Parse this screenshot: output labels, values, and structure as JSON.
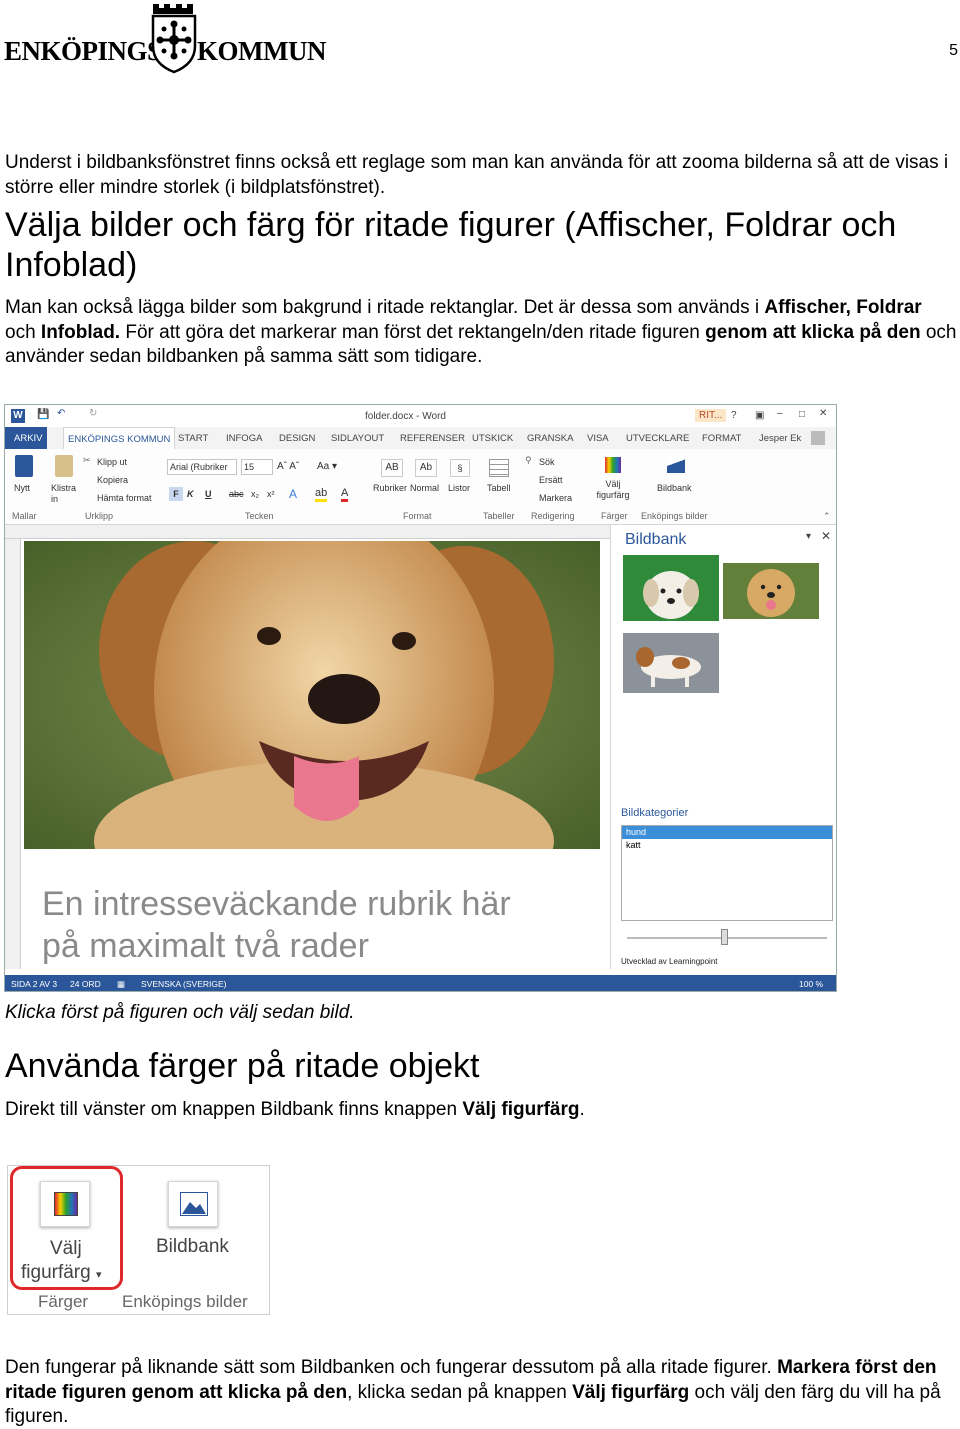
{
  "header": {
    "logo_text_left": "ENKÖPINGS",
    "logo_text_right": "KOMMUN",
    "page_number": "5"
  },
  "intro": "Underst i bildbanksfönstret finns också ett reglage som man kan använda för att zooma bilderna så att de visas i större eller mindre storlek (i bildplatsfönstret).",
  "section1": {
    "heading": "Välja bilder och färg för ritade figurer (Affischer, Foldrar och Infoblad)",
    "p_a": "Man kan också lägga bilder som bakgrund i ritade rektanglar. Det är dessa som används i ",
    "p_b": "Affischer, Foldrar",
    "p_c": " och ",
    "p_d": "Infoblad.",
    "p_e": " För att göra det markerar man först det rektangeln/den ritade figuren ",
    "p_f": "genom att klicka på den",
    "p_g": " och använder sedan bildbanken på samma sätt som tidigare."
  },
  "screenshot": {
    "title": "folder.docx - Word",
    "title_right": "RIT...",
    "user": "Jesper Ek",
    "tabs": [
      "ARKIV",
      "ENKÖPINGS KOMMUN",
      "START",
      "INFOGA",
      "DESIGN",
      "SIDLAYOUT",
      "REFERENSER",
      "UTSKICK",
      "GRANSKA",
      "VISA",
      "UTVECKLARE",
      "FORMAT"
    ],
    "ribbon": {
      "nytt": "Nytt",
      "klistra": "Klistra in",
      "klipp": "Klipp ut",
      "kopiera": "Kopiera",
      "hamta": "Hämta format",
      "font": "Arial (Rubriker",
      "size": "15",
      "rubriker": "Rubriker",
      "normal": "Normal",
      "listor": "Listor",
      "tabell": "Tabell",
      "sok": "Sök",
      "ersatt": "Ersätt",
      "markera": "Markera",
      "valj": "Välj figurfärg",
      "bildbank": "Bildbank",
      "g_mallar": "Mallar",
      "g_urklipp": "Urklipp",
      "g_tecken": "Tecken",
      "g_format": "Format",
      "g_tabeller": "Tabeller",
      "g_redigering": "Redigering",
      "g_farger": "Färger",
      "g_enk": "Enköpings bilder"
    },
    "doc_heading_1": "En intresseväckande rubrik här",
    "doc_heading_2": "på maximalt två rader",
    "pane": {
      "title": "Bildbank",
      "categories_title": "Bildkategorier",
      "categories": [
        "hund",
        "katt"
      ],
      "footer": "Utvecklad av Learningpoint"
    },
    "status": {
      "page": "SIDA 2 AV 3",
      "words": "24 ORD",
      "lang": "SVENSKA (SVERIGE)",
      "zoom": "100 %"
    }
  },
  "caption": "Klicka först på figuren och välj sedan bild.",
  "section2": {
    "heading": "Använda färger på ritade objekt",
    "p_a": "Direkt till vänster om knappen Bildbank finns knappen ",
    "p_b": "Välj figurfärg",
    "p_c": "."
  },
  "crop": {
    "valj_1": "Välj",
    "valj_2": "figurfärg",
    "bildbank": "Bildbank",
    "farger": "Färger",
    "enk": "Enköpings bilder"
  },
  "outro": {
    "p_a": "Den fungerar på liknande sätt som Bildbanken och fungerar dessutom på alla ritade figurer. ",
    "p_b": "Markera först den ritade figuren genom att klicka på den",
    "p_c": ", klicka sedan på knappen ",
    "p_d": "Välj figurfärg",
    "p_e": " och välj den färg du vill ha på figuren."
  },
  "colors": {
    "word_blue": "#2b579a",
    "highlight": "#e0282a",
    "select_blue": "#3b8fd9"
  }
}
